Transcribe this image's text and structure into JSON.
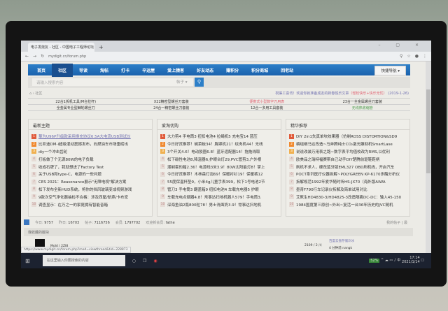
{
  "browser": {
    "tab_title": "电子发烧友 - 社区 - 中国电子工程师论坛",
    "url": "mydigit.cn/forum.php",
    "window_controls": "– ▢ ×"
  },
  "nav": {
    "items": [
      "首页",
      "社区",
      "导读",
      "淘帖",
      "打卡",
      "辛运屋",
      "爱上猿客",
      "好友动态",
      "赚积分",
      "积分商城",
      "回老站"
    ],
    "active": 1,
    "quick": "快捷导航 ▾"
  },
  "search": {
    "placeholder": "请输入搜索内容",
    "scope": "帖子 ▾"
  },
  "breadcrumb": "⌂ › 社区",
  "notice": {
    "text": "祝渠工喜讯！欢迎你就准备成友的新春悦乐文章",
    "highlight": "（轻松快乐+快乐无忧）",
    "date": "(2019-1-26)"
  },
  "quick_links": [
    [
      "22合1拆机工具(M合拉杆)",
      "X22精密型螺丝刀套装",
      "便携式小型数字万用表",
      "23合一全金属螺丝刀套装"
    ],
    [
      "全金属专业型棘轮螺丝刀",
      "24合一精密螺丝刀套装",
      "12合一多用工具套装",
      "无线热收缩管"
    ]
  ],
  "columns": [
    {
      "title": "最新主题",
      "items": [
        "華为U96P升级款采用换充协议6.5A大电流USB测试仪",
        "比亚迪DM-i超级混动震撼发布，向燃油车市场重磅出",
        "diy一个冲击齿轮",
        "打板做了个无源80W的电子负载",
        "收成石牌了，我就想进了Factory Test",
        "关于USB和type-C，电源的一些问题",
        "CES 2021：Reasonance展示\"无障电视\"解决方案",
        "松下发布全新HUD系统，将你的挡风玻璃变成视频游戏",
        "9款次空气净化器抽检不合格：涉及西屋/航燕/卡布宏",
        "调查显示：在万之一的家庭拥有智能音箱"
      ]
    },
    {
      "title": "爱淘优购",
      "items": [
        "大力剪4 手电筒3 扭扣电池4 拉绳机5 充电宝14 蓝压",
        "今日好货推荐！碗菜板34！胸罩机21！纹肉机44！无线",
        "3个开关4.6！电动胶圈6.8！蓝牙适配器14！拖拖线取",
        "松下碳性电池8,降温器6,护眼台灯29,PVC管剪3,户外根",
        "潮剃套的箱2.36！电源线3米3.9！80W太阳能灯8！掌上",
        "今日好货推荐！木林森灯泡69！保暖衬衫19！保暖裤12",
        "55度保温杯垫9，小米4g儿童手表399，松下1号电池2节",
        "管刀3 手电筒3 翻盖箱9 纽扣电池4 车载充电器5 护眼",
        "车载充电点烟器4.8！常事达扫地机器人579！手电筒3.",
        "深海鱼油2瓶800粒78！男士洗面奶3.9！常事达扫地机"
      ]
    },
    {
      "title": "精华推荐",
      "items": [
        "DIY 2in1失真单块效果器（仿制ROSS DISTORTION&SD9",
        "编组细马达改造~马奔腾纯士CO₂激光雕刻机SmartLase",
        "说说改装万用表之路~数字表平均值校改为RMS,以优利",
        "欧美品之瑞特福赛斯自己动手DIY楚腾前驱鞋鞋柄",
        "刷机不求人，硬改蓝牙版EML327 OBD刷机线，开启汽车",
        "POCT系列医疗仪器拆解~POLYGREEN KP-6170多酶分析仪",
        "拆解规范1992年爱华随时听HS-JX70（海外版AIWA",
        "墨青F790行车记录仪拆解及简单试用对比",
        "艾默生HD4830-3/HD4825-3改造隔离DC-DC：输入45-150",
        "1984国度第三原创~外出~复活一台36年历史的JVC随机"
      ]
    }
  ],
  "stats": {
    "today_label": "今日:",
    "today": "9757",
    "yesterday_label": "昨日:",
    "yesterday": "16703",
    "posts_label": "帖子:",
    "posts": "7116756",
    "members_label": "会员:",
    "members": "1797702",
    "newest_label": "欢迎新会员:",
    "newest": "fathe",
    "my_posts": "我的帖子 | 最"
  },
  "favorites": {
    "title": "我收藏的版块"
  },
  "forum_item": {
    "meta": "Mold | 2ZJ8",
    "count": "2109 / 2 川",
    "last": "百度云盘存储冷冰",
    "by": "4 分钟前 nangk"
  },
  "status_url": "https://www.mydigit.cn/forum.php?mod=viewthread&tid=228873",
  "taskbar": {
    "search_placeholder": "在这里输入你要搜索的内容",
    "battery": "52%",
    "ime": "中",
    "time": "17:14",
    "date": "2021/1/14"
  },
  "colors": {
    "nav": "#1b62ad",
    "accent": "#2d7fc8",
    "hot": "#e05a3a",
    "warm": "#f08a30",
    "mild": "#f0b050"
  }
}
